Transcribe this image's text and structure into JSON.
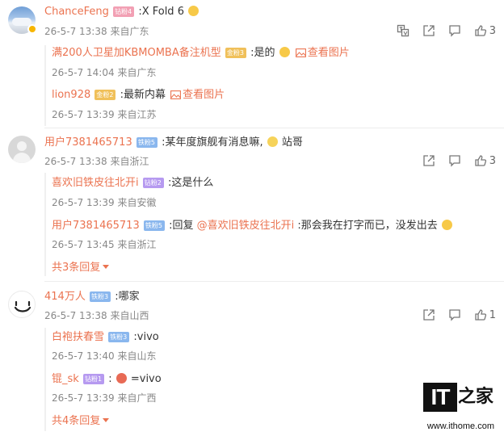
{
  "comments": [
    {
      "username": "ChanceFeng",
      "badge": "钻粉4",
      "text": ":X Fold 6",
      "time": "26-5-7 13:38",
      "location": "来自广东",
      "likes": "3",
      "replies": [
        {
          "username": "满200人卫星加KBMOMBA备注机型",
          "badge": "金粉3",
          "text": ":是的",
          "pic_label": "查看图片",
          "time": "26-5-7 14:04",
          "location": "来自广东"
        },
        {
          "username": "lion928",
          "badge": "金粉2",
          "text": ":最新内幕",
          "pic_label": "查看图片",
          "time": "26-5-7 13:39",
          "location": "来自江苏"
        }
      ]
    },
    {
      "username": "用户7381465713",
      "badge": "铁粉5",
      "text": ":某年度旗舰有消息嘛,",
      "text_after": "站哥",
      "time": "26-5-7 13:38",
      "location": "来自浙江",
      "likes": "3",
      "replies": [
        {
          "username": "喜欢旧铁皮往北开i",
          "badge": "钻粉2",
          "text": ":这是什么",
          "time": "26-5-7 13:39",
          "location": "来自安徽"
        },
        {
          "username": "用户7381465713",
          "badge": "铁粉5",
          "text": ":回复",
          "mention": "@喜欢旧铁皮往北开i",
          "text_after": ":那会我在打字而已，没发出去",
          "time": "26-5-7 13:45",
          "location": "来自浙江"
        }
      ],
      "more_replies": "共3条回复"
    },
    {
      "username": "414万人",
      "badge": "铁粉3",
      "text": ":哪家",
      "time": "26-5-7 13:38",
      "location": "来自山西",
      "likes": "1",
      "replies": [
        {
          "username": "白袍扶春雪",
          "badge": "铁粉3",
          "text": ":vivo",
          "time": "26-5-7 13:40",
          "location": "来自山东"
        },
        {
          "username": "锟_sk",
          "badge": "钻粉1",
          "text": ":",
          "text_after": "=vivo",
          "time": "26-5-7 13:39",
          "location": "来自广西"
        }
      ],
      "more_replies": "共4条回复"
    }
  ],
  "watermark": {
    "logo_it": "IT",
    "logo_zh": "之家",
    "url": "www.ithome.com"
  },
  "icons": [
    "translate-icon",
    "share-icon",
    "comment-icon",
    "like-icon",
    "image-icon",
    "caret-down-icon",
    "verified-badge-icon"
  ],
  "colors": {
    "username": "#eb7350",
    "meta": "#888888",
    "text": "#333333"
  }
}
